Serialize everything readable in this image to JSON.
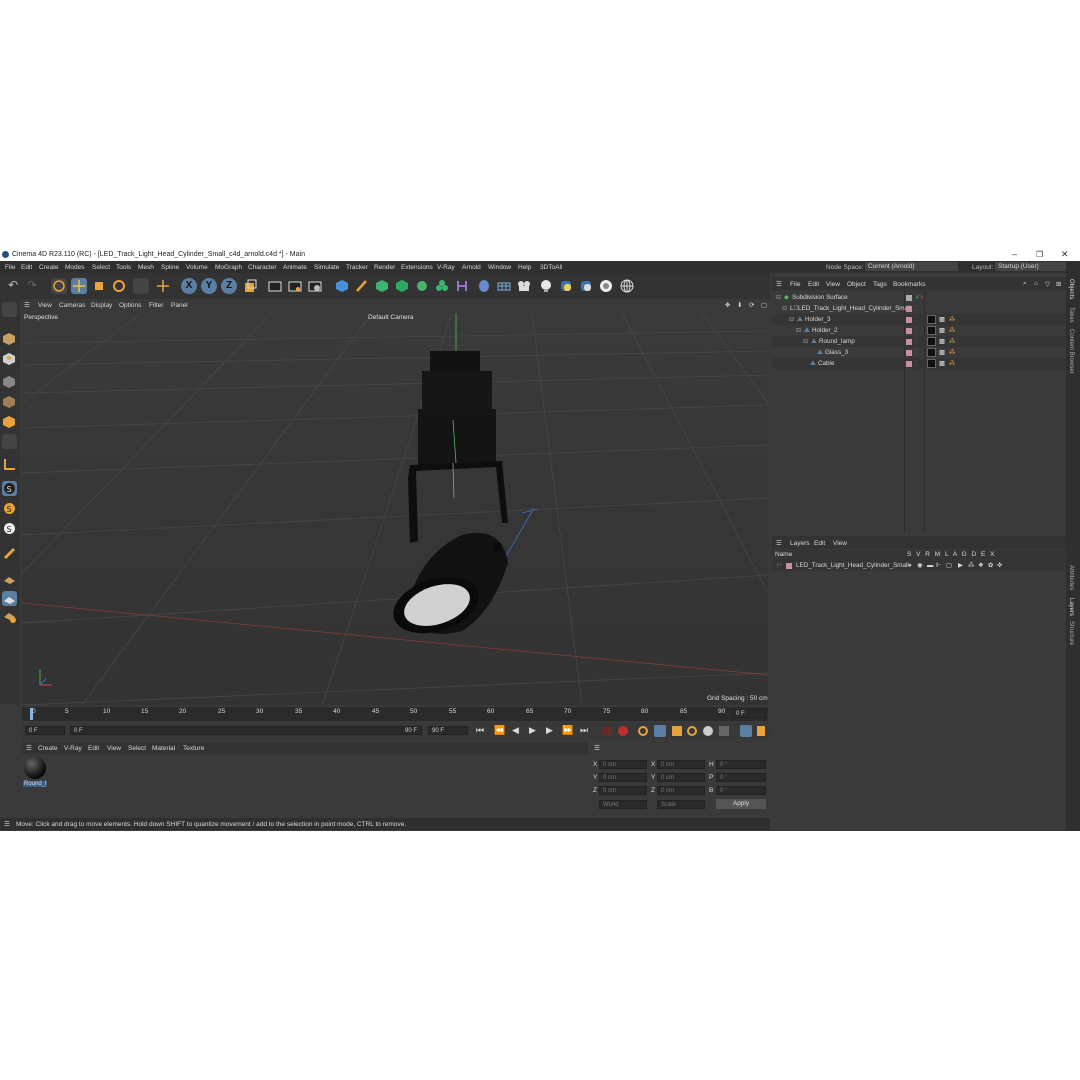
{
  "window": {
    "title": "Cinema 4D R23.110 (RC) - [LED_Track_Light_Head_Cylinder_Small_c4d_arnold.c4d *] - Main"
  },
  "menubar": {
    "items": [
      "File",
      "Edit",
      "Create",
      "Modes",
      "Select",
      "Tools",
      "Mesh",
      "Spline",
      "Volume",
      "MoGraph",
      "Character",
      "Animate",
      "Simulate",
      "Tracker",
      "Render",
      "Extensions",
      "V-Ray",
      "Arnold",
      "Window",
      "Help",
      "3DToAll"
    ],
    "node_space_label": "Node Space:",
    "node_space_value": "Current (Arnold)",
    "layout_label": "Layout:",
    "layout_value": "Startup (User)"
  },
  "toolbar": {
    "axis_x": "X",
    "axis_y": "Y",
    "axis_z": "Z"
  },
  "viewport": {
    "menu": [
      "View",
      "Cameras",
      "Display",
      "Options",
      "Filter",
      "Panel"
    ],
    "projection": "Perspective",
    "camera": "Default Camera",
    "grid_spacing": "Grid Spacing : 50 cm"
  },
  "timeline": {
    "ticks": [
      "0",
      "5",
      "10",
      "15",
      "20",
      "25",
      "30",
      "35",
      "40",
      "45",
      "50",
      "55",
      "60",
      "65",
      "70",
      "75",
      "80",
      "85",
      "90"
    ],
    "current_frame": "0 F",
    "start_frame": "0 F",
    "range_start": "0 F",
    "range_end": "90 F",
    "end_frame": "90 F",
    "end_frame2": "90 F"
  },
  "material_manager": {
    "menu": [
      "Create",
      "V-Ray",
      "Edit",
      "View",
      "Select",
      "Material",
      "Texture"
    ],
    "materials": [
      {
        "name": "Round_l"
      }
    ]
  },
  "coords": {
    "x_label": "X",
    "y_label": "Y",
    "z_label": "Z",
    "x_pos": "0 cm",
    "y_pos": "0 cm",
    "z_pos": "0 cm",
    "x_size": "0 cm",
    "y_size": "0 cm",
    "z_size": "0 cm",
    "h_label": "H",
    "p_label": "P",
    "b_label": "B",
    "h_val": "0 °",
    "p_val": "0 °",
    "b_val": "0 °",
    "mode1": "World",
    "mode2": "Scale",
    "apply": "Apply"
  },
  "status": "Move: Click and drag to move elements. Hold down SHIFT to quantize movement / add to the selection in point mode, CTRL to remove.",
  "object_manager": {
    "menu": [
      "File",
      "Edit",
      "View",
      "Object",
      "Tags",
      "Bookmarks"
    ],
    "objects": [
      {
        "name": "Subdivision Surface",
        "depth": 0
      },
      {
        "name": "LED_Track_Light_Head_Cylinder_Small",
        "depth": 1
      },
      {
        "name": "Holder_3",
        "depth": 2
      },
      {
        "name": "Holder_2",
        "depth": 3
      },
      {
        "name": "Round_lamp",
        "depth": 4
      },
      {
        "name": "Glass_3",
        "depth": 5
      },
      {
        "name": "Cable",
        "depth": 4
      }
    ]
  },
  "layer_manager": {
    "menu": [
      "Layers",
      "Edit",
      "View"
    ],
    "col_name": "Name",
    "col_flags": "S V R M L A G D E X",
    "layers": [
      {
        "name": "LED_Track_Light_Head_Cylinder_Small"
      }
    ]
  },
  "right_tabs": [
    "Objects",
    "Takes",
    "Content Browser",
    "Attributes",
    "Layers",
    "Structure"
  ],
  "colors": {
    "accent": "#5a7fa3",
    "layer_color": "#c890a0",
    "background": "#3a3a3a"
  }
}
